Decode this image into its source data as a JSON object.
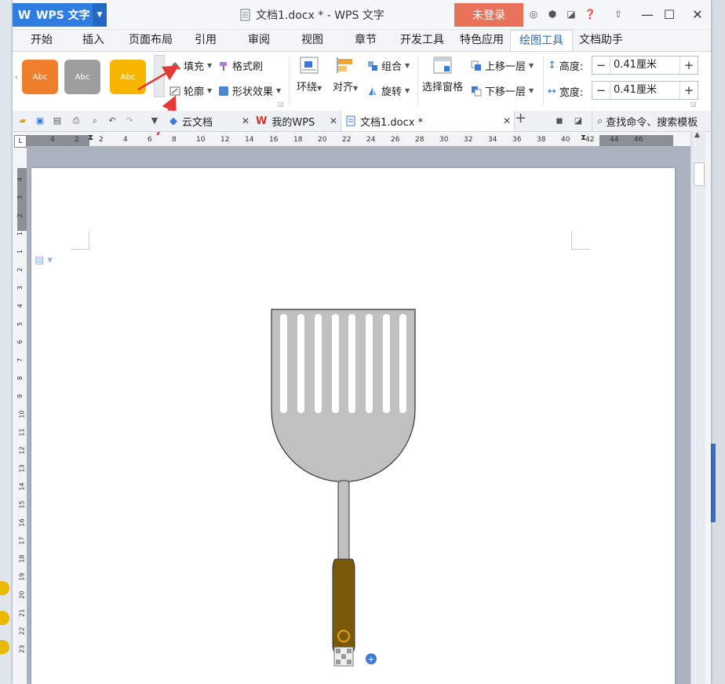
{
  "app": {
    "name": "WPS 文字",
    "logo": "W"
  },
  "titlebar": {
    "doc_title": "文档1.docx * - WPS 文字",
    "login_label": "未登录",
    "accent": "#2f7de0",
    "login_color": "#e8725a"
  },
  "menu_tabs": [
    "开始",
    "插入",
    "页面布局",
    "引用",
    "审阅",
    "视图",
    "章节",
    "开发工具",
    "特色应用",
    "绘图工具",
    "文档助手"
  ],
  "active_tab": "绘图工具",
  "ribbon": {
    "swatches": [
      {
        "label": "Abc",
        "color": "#ef7f2d"
      },
      {
        "label": "Abc",
        "color": "#9e9e9e"
      },
      {
        "label": "Abc",
        "color": "#f7b500"
      }
    ],
    "fill_label": "填充",
    "format_painter_label": "格式刷",
    "outline_label": "轮廓",
    "shape_effect_label": "形状效果",
    "wrap_label": "环绕",
    "align_label": "对齐",
    "group_label": "组合",
    "rotate_label": "旋转",
    "selection_pane_label": "选择窗格",
    "bring_forward_label": "上移一层",
    "send_backward_label": "下移一层",
    "height_label": "高度:",
    "height_value": "0.41厘米",
    "width_label": "宽度:",
    "width_value": "0.41厘米"
  },
  "doc_tabs": [
    {
      "label": "云文档"
    },
    {
      "label": "我的WPS"
    },
    {
      "label": "文档1.docx *"
    }
  ],
  "search_command_label": "查找命令、搜索模板",
  "ruler": {
    "h_labels": [
      "4",
      "2",
      "2",
      "4",
      "6",
      "8",
      "10",
      "12",
      "14",
      "16",
      "18",
      "20",
      "22",
      "24",
      "26",
      "28",
      "30",
      "32",
      "34",
      "36",
      "38",
      "40",
      "42",
      "44",
      "46"
    ],
    "v_labels": [
      "4",
      "3",
      "2",
      "1",
      "1",
      "2",
      "3",
      "4",
      "5",
      "6",
      "7",
      "8",
      "9",
      "10",
      "11",
      "12",
      "13",
      "14",
      "15",
      "16",
      "17",
      "18",
      "19",
      "20",
      "21",
      "22",
      "23"
    ]
  },
  "drawing": {
    "spatula_head_color": "#c0c0c0",
    "handle_color": "#7a5a0a"
  }
}
